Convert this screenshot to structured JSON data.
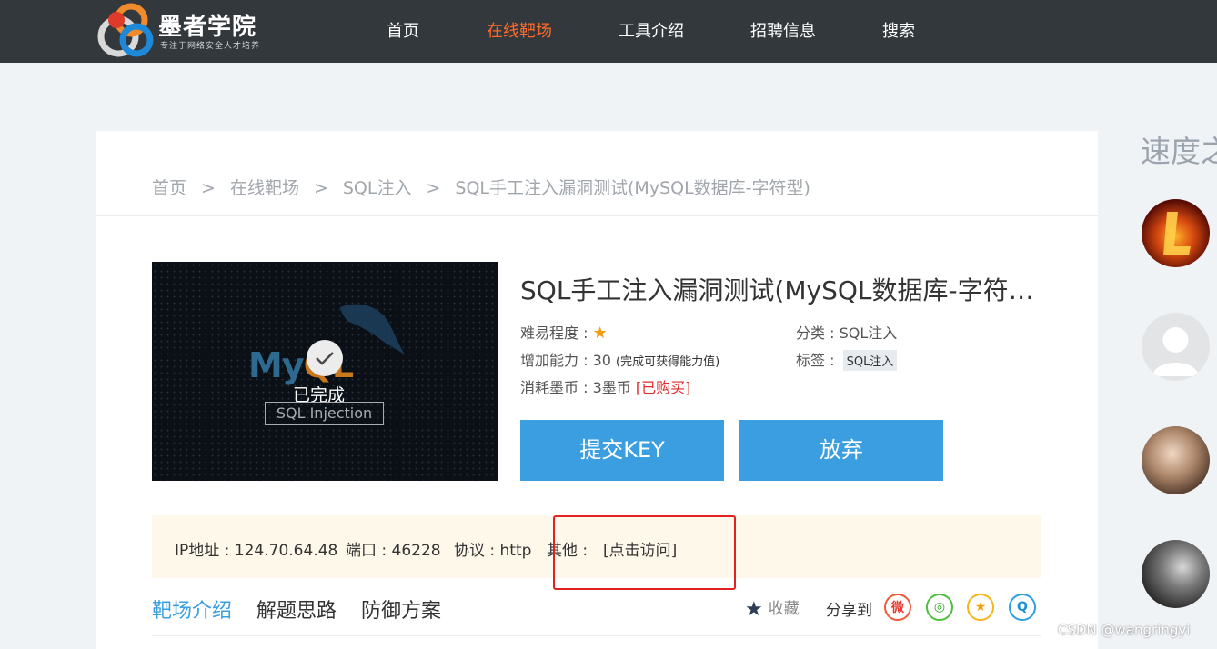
{
  "nav": {
    "logo_title": "墨者学院",
    "logo_subtitle": "专注于网络安全人才培养",
    "items": [
      {
        "label": "首页",
        "active": false
      },
      {
        "label": "在线靶场",
        "active": true
      },
      {
        "label": "工具介绍",
        "active": false
      },
      {
        "label": "招聘信息",
        "active": false
      },
      {
        "label": "搜索",
        "active": false
      }
    ]
  },
  "breadcrumb": [
    "首页",
    "在线靶场",
    "SQL注入",
    "SQL手工注入漏洞测试(MySQL数据库-字符型)"
  ],
  "breadcrumb_sep": ">",
  "thumbnail": {
    "brand_my": "My",
    "brand_ql": "QL",
    "status": "已完成",
    "caption": "SQL Injection"
  },
  "detail": {
    "title": "SQL手工注入漏洞测试(MySQL数据库-字符型)",
    "difficulty_label": "难易程度 :",
    "difficulty_stars": 1,
    "ability_label": "增加能力 : 30",
    "ability_note": "(完成可获得能力值)",
    "cost_label": "消耗墨币 : 3墨币",
    "cost_status": "[已购买]",
    "category_label": "分类 : SQL注入",
    "tags_label": "标签 :",
    "tag": "SQL注入"
  },
  "buttons": {
    "submit": "提交KEY",
    "abandon": "放弃"
  },
  "ip_bar": {
    "ip": "IP地址 : 124.70.64.48",
    "port": "端口 : 46228",
    "protocol": "协议 : http",
    "other_label": "其他 :",
    "visit_link": "[点击访问]"
  },
  "tabs": [
    {
      "label": "靶场介绍",
      "active": true
    },
    {
      "label": "解题思路",
      "active": false
    },
    {
      "label": "防御方案",
      "active": false
    }
  ],
  "actions": {
    "favorite": "收藏",
    "share_label": "分享到",
    "share_icons": [
      "weibo-icon",
      "wechat-icon",
      "qzone-icon",
      "qq-icon"
    ]
  },
  "sidebar": {
    "title": "速度之"
  },
  "watermark": "CSDN @wangringyi",
  "colors": {
    "nav_bg": "#33383d",
    "accent_orange": "#ff6a2a",
    "button_blue": "#3a9ee0",
    "highlight_red": "#e0211f"
  }
}
